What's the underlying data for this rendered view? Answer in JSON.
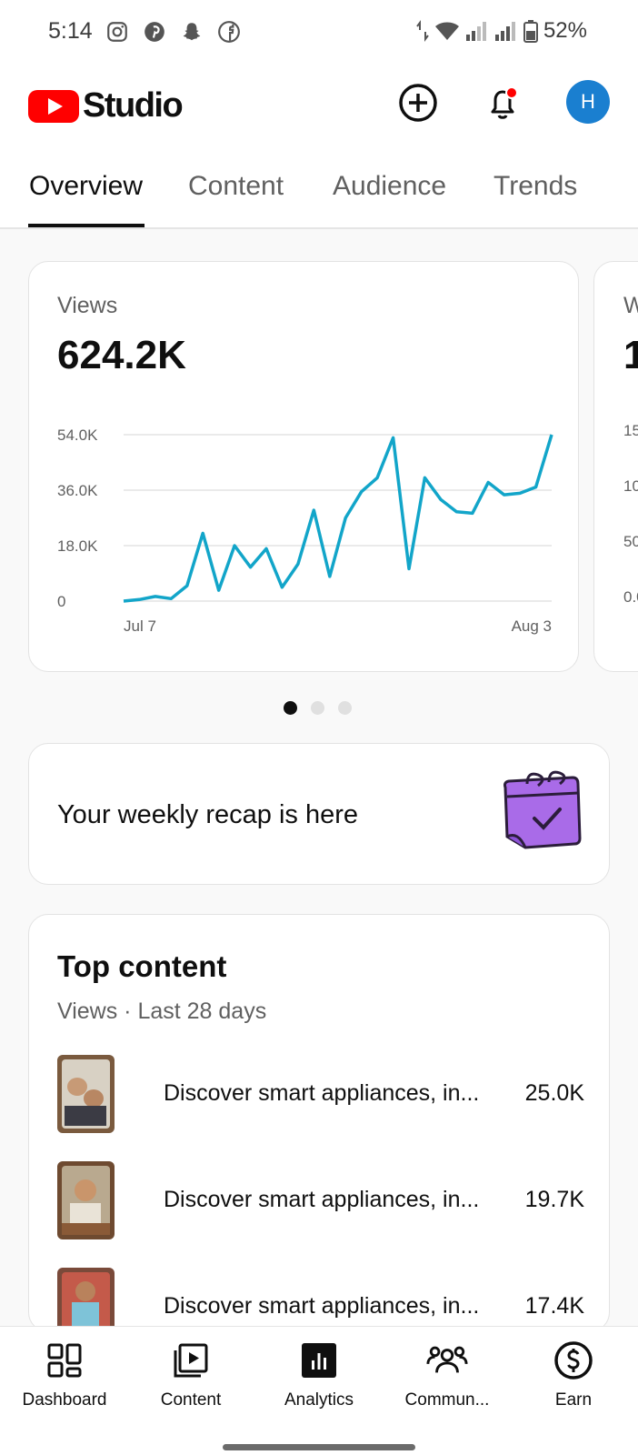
{
  "status_bar": {
    "time": "5:14",
    "battery": "52%",
    "left_icons": [
      "instagram-icon",
      "pinterest-icon",
      "snapchat-icon",
      "facebook-icon"
    ],
    "right_icons": [
      "data-arrows-icon",
      "wifi-icon",
      "signal-icon",
      "signal-icon",
      "battery-icon"
    ]
  },
  "header": {
    "brand": "Studio",
    "avatar_initial": "H",
    "icons": [
      "create-icon",
      "notifications-icon"
    ],
    "notification_dot_color": "#ff0000"
  },
  "tabs": [
    {
      "label": "Overview",
      "active": true
    },
    {
      "label": "Content",
      "active": false
    },
    {
      "label": "Audience",
      "active": false
    },
    {
      "label": "Trends",
      "active": false
    }
  ],
  "views_card": {
    "label": "Views",
    "value": "624.2K"
  },
  "peek_card": {
    "label": "W",
    "value": "1",
    "ticks": [
      "15",
      "10",
      "50",
      "0.0"
    ]
  },
  "chart_data": {
    "type": "line",
    "title": "",
    "xlabel": "",
    "ylabel": "",
    "x_tick_labels": [
      "Jul 7",
      "Aug 3"
    ],
    "y_tick_labels": [
      "54.0K",
      "36.0K",
      "18.0K",
      "0"
    ],
    "ylim": [
      0,
      54000
    ],
    "grid": true,
    "color": "#12a5c9",
    "series": [
      {
        "x": [
          "Jul 7",
          "Jul 8",
          "Jul 9",
          "Jul 10",
          "Jul 11",
          "Jul 12",
          "Jul 13",
          "Jul 14",
          "Jul 15",
          "Jul 16",
          "Jul 17",
          "Jul 18",
          "Jul 19",
          "Jul 20",
          "Jul 21",
          "Jul 22",
          "Jul 23",
          "Jul 24",
          "Jul 25",
          "Jul 26",
          "Jul 27",
          "Jul 28",
          "Jul 29",
          "Jul 30",
          "Jul 31",
          "Aug 1",
          "Aug 2",
          "Aug 3"
        ],
        "values": [
          0,
          500,
          1500,
          800,
          5000,
          22000,
          3500,
          18000,
          11000,
          17000,
          4500,
          12000,
          29500,
          8000,
          27000,
          35500,
          40000,
          53000,
          10500,
          40000,
          33000,
          29000,
          28500,
          38500,
          34500,
          35000,
          37000,
          54000
        ]
      }
    ]
  },
  "pager": {
    "count": 3,
    "active": 0
  },
  "recap": {
    "text": "Your weekly recap is here",
    "icon": "calendar-check-icon"
  },
  "top_content": {
    "title": "Top content",
    "subtitle": "Views · Last 28 days",
    "items": [
      {
        "title": "Discover smart appliances, in...",
        "views": "25.0K"
      },
      {
        "title": "Discover smart appliances, in...",
        "views": "19.7K"
      },
      {
        "title": "Discover smart appliances, in...",
        "views": "17.4K"
      }
    ]
  },
  "bottom_nav": [
    {
      "label": "Dashboard",
      "icon": "dashboard-icon",
      "active": false
    },
    {
      "label": "Content",
      "icon": "content-icon",
      "active": false
    },
    {
      "label": "Analytics",
      "icon": "analytics-icon",
      "active": true
    },
    {
      "label": "Commun...",
      "icon": "community-icon",
      "active": false
    },
    {
      "label": "Earn",
      "icon": "earn-icon",
      "active": false
    }
  ]
}
